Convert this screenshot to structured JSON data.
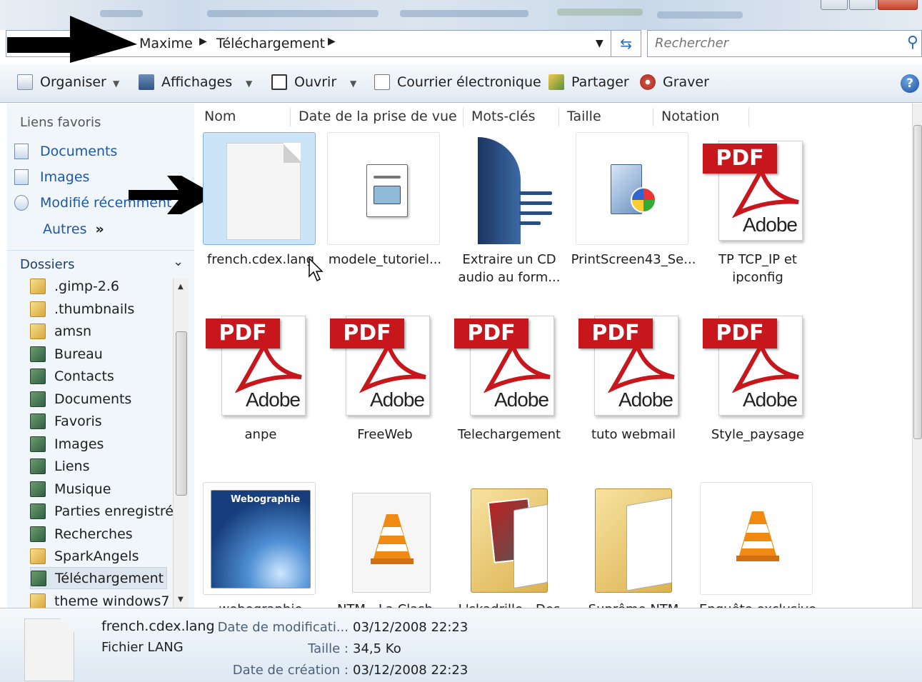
{
  "window": {
    "breadcrumb": [
      "Maxime",
      "Téléchargement"
    ],
    "search_placeholder": "Rechercher"
  },
  "toolbar": {
    "organiser": "Organiser",
    "affichages": "Affichages",
    "ouvrir": "Ouvrir",
    "courrier": "Courrier électronique",
    "partager": "Partager",
    "graver": "Graver",
    "help": "?"
  },
  "nav": {
    "favorites_title": "Liens favoris",
    "favorites": [
      "Documents",
      "Images",
      "Modifié récemment"
    ],
    "more": "Autres",
    "more_glyph": "»",
    "folders_title": "Dossiers",
    "folders": [
      ".gimp-2.6",
      ".thumbnails",
      "amsn",
      "Bureau",
      "Contacts",
      "Documents",
      "Favoris",
      "Images",
      "Liens",
      "Musique",
      "Parties enregistrée",
      "Recherches",
      "SparkAngels",
      "Téléchargement",
      "theme windows7"
    ],
    "selected_folder": "Téléchargement"
  },
  "columns": [
    "Nom",
    "Date de la prise de vue",
    "Mots-clés",
    "Taille",
    "Notation"
  ],
  "files": [
    {
      "name": "french.cdex.lang",
      "name2": "",
      "type": "blank",
      "selected": true
    },
    {
      "name": "modele_tutoriel...",
      "name2": "",
      "type": "doc"
    },
    {
      "name": "Extraire un CD",
      "name2": "audio au form...",
      "type": "writer"
    },
    {
      "name": "PrintScreen43_Se...",
      "name2": "",
      "type": "setup"
    },
    {
      "name": "TP TCP_IP et",
      "name2": "ipconfig",
      "type": "pdf"
    },
    {
      "name": "anpe",
      "name2": "",
      "type": "pdf"
    },
    {
      "name": "FreeWeb",
      "name2": "",
      "type": "pdf"
    },
    {
      "name": "Telechargement",
      "name2": "",
      "type": "pdf"
    },
    {
      "name": "tuto webmail",
      "name2": "",
      "type": "pdf"
    },
    {
      "name": "Style_paysage",
      "name2": "",
      "type": "pdf"
    },
    {
      "name": "webographie",
      "name2": "",
      "type": "image"
    },
    {
      "name": "NTM - La Clash",
      "name2": "",
      "type": "vlc"
    },
    {
      "name": "L'skadrille - Des",
      "name2": "",
      "type": "folder"
    },
    {
      "name": "Suprême NTM",
      "name2": "",
      "type": "folder"
    },
    {
      "name": "Enquête exclusive",
      "name2": "",
      "type": "vlc"
    }
  ],
  "pdf_label": "PDF",
  "adobe_label": "Adobe",
  "image_caption": "Webographie",
  "details": {
    "filename": "french.cdex.lang",
    "filetype": "Fichier LANG",
    "modified_key": "Date de modificati...",
    "modified_val": "03/12/2008 22:23",
    "size_key": "Taille :",
    "size_val": "34,5 Ko",
    "created_key": "Date de création :",
    "created_val": "03/12/2008 22:23"
  },
  "colors": {
    "accent": "#1c58a6",
    "pdf_red": "#c8161d",
    "selection": "#cce4f8"
  }
}
